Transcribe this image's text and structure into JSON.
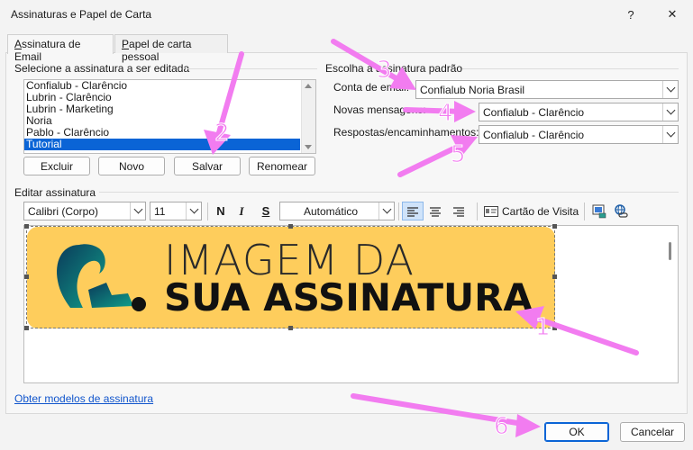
{
  "window": {
    "title": "Assinaturas e Papel de Carta",
    "help_symbol": "?",
    "close_symbol": "✕"
  },
  "tabs": [
    {
      "label": "Assinatura de Email",
      "underline": "A",
      "rest": "ssinatura de Email"
    },
    {
      "label": "Papel de carta pessoal",
      "underline": "P",
      "rest": "apel de carta pessoal"
    }
  ],
  "left_group": {
    "label": "Selecione a assinatura a ser editada",
    "items": [
      "Confialub - Clarêncio",
      "Lubrin - Clarêncio",
      "Lubrin - Marketing",
      "Noria",
      "Pablo - Clarêncio",
      "Tutorial"
    ],
    "selected_index": 5,
    "buttons": {
      "delete": "Excluir",
      "new": "Novo",
      "save": "Salvar",
      "rename": "Renomear"
    }
  },
  "right_group": {
    "label": "Escolha a assinatura padrão",
    "account_label": "Conta de email:",
    "account_value": "Confialub Noria Brasil",
    "new_messages_label": "Novas mensagens:",
    "new_messages_value": "Confialub - Clarêncio",
    "replies_label": "Respostas/encaminhamentos:",
    "replies_value": "Confialub - Clarêncio"
  },
  "editor": {
    "label": "Editar assinatura",
    "font_family": "Calibri (Corpo)",
    "font_size": "11",
    "bold": "N",
    "italic": "I",
    "underline": "S",
    "color": "Automático",
    "business_card": "Cartão de Visita",
    "banner_line1": "IMAGEM DA",
    "banner_line2": "SUA ASSINATURA"
  },
  "footer": {
    "templates_link": "Obter modelos de assinatura",
    "ok": "OK",
    "cancel": "Cancelar"
  },
  "annotations": {
    "n1": "1",
    "n2": "2",
    "n3": "3",
    "n4": "4",
    "n5": "5",
    "n6": "6",
    "color": "#f27cf0"
  },
  "colors": {
    "selection": "#0a64d6",
    "banner": "#fecd5c",
    "link": "#1155cc",
    "focus_border": "#0a64d6"
  }
}
